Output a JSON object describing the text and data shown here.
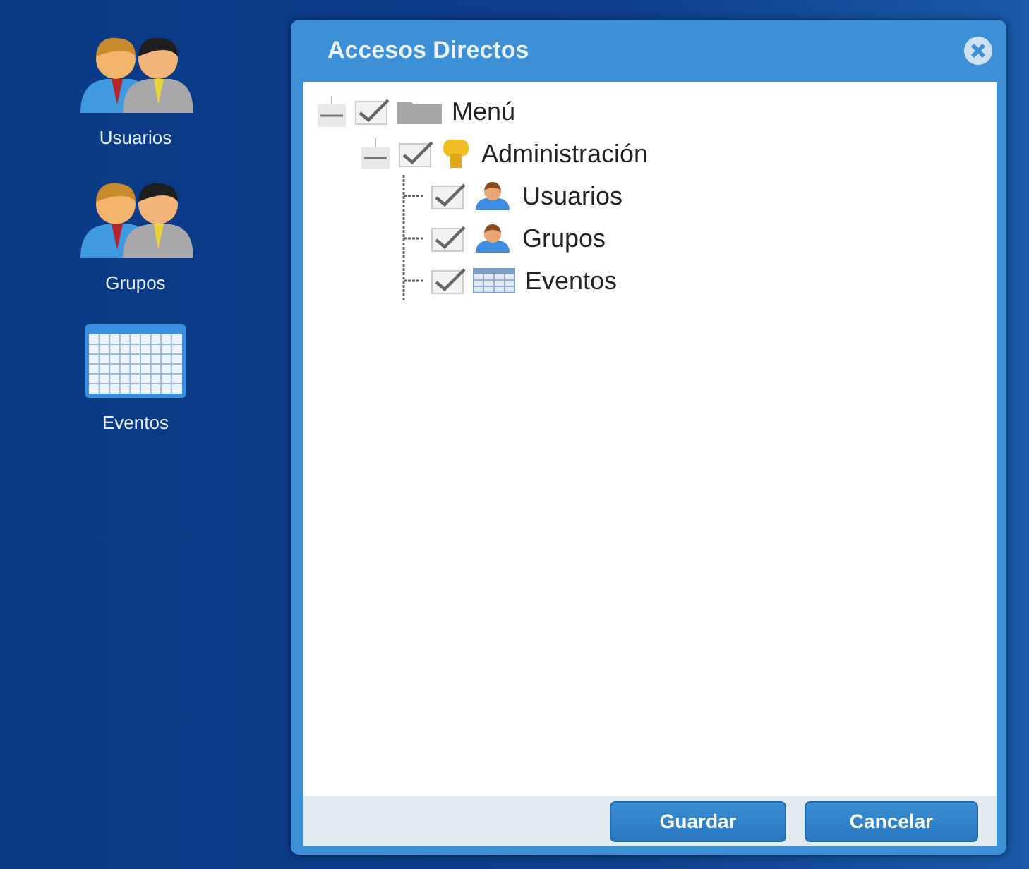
{
  "desktop_icons": [
    {
      "label": "Usuarios",
      "kind": "users"
    },
    {
      "label": "Grupos",
      "kind": "users"
    },
    {
      "label": "Eventos",
      "kind": "calendar"
    }
  ],
  "dialog": {
    "title": "Accesos Directos",
    "tree": [
      {
        "label": "Menú",
        "kind": "folder",
        "checked": true,
        "expanded": true,
        "children": [
          {
            "label": "Administración",
            "kind": "key",
            "checked": true,
            "expanded": true,
            "children": [
              {
                "label": "Usuarios",
                "kind": "user",
                "checked": true
              },
              {
                "label": "Grupos",
                "kind": "user",
                "checked": true
              },
              {
                "label": "Eventos",
                "kind": "table",
                "checked": true
              }
            ]
          }
        ]
      }
    ],
    "buttons": [
      "Guardar",
      "Cancelar"
    ]
  }
}
